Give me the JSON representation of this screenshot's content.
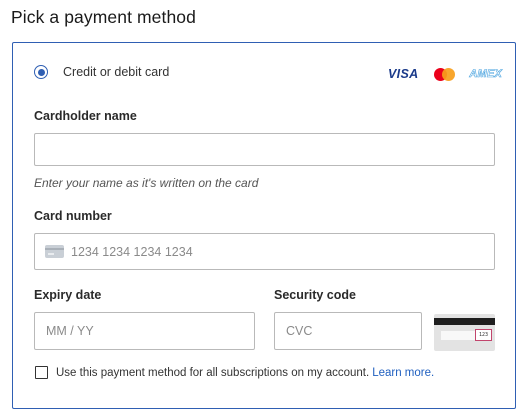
{
  "page": {
    "title": "Pick a payment method"
  },
  "method": {
    "label": "Credit or debit card",
    "selected": true,
    "brands": {
      "visa": "VISA",
      "mastercard": "mastercard-logo",
      "amex": "AMEX"
    }
  },
  "cardholder": {
    "label": "Cardholder name",
    "value": "",
    "placeholder": "",
    "help": "Enter your name as it's written on the card"
  },
  "card_number": {
    "label": "Card number",
    "placeholder": "1234 1234 1234 1234",
    "icon": "credit-card-icon"
  },
  "expiry": {
    "label": "Expiry date",
    "placeholder": "MM / YY"
  },
  "security": {
    "label": "Security code",
    "placeholder": "CVC",
    "illustration_code": "123"
  },
  "save": {
    "checked": false,
    "text": "Use this payment method for all subscriptions on my account.",
    "link": "Learn more."
  },
  "colors": {
    "accent": "#2f5fb3",
    "link": "#1f5fbf",
    "visa": "#1a3a8a",
    "mastercard_red": "#eb001b",
    "mastercard_orange": "#f79e1b",
    "amex": "#4aa3df"
  }
}
